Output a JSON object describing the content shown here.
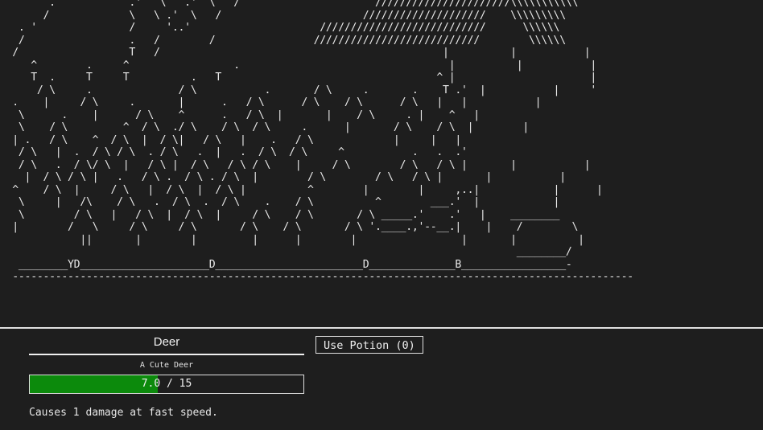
{
  "scene": {
    "art_lines": [
      "        .            .'   \\   .'  \\   /                      //////////////////////\\\\\\\\\\\\\\\\\\\\\\",
      "       /             \\   \\ .'  \\   /                       ////////////////////    \\\\\\\\\\\\\\\\\\",
      "   . '               /     '..'                     ///////////////////////////      \\\\\\\\\\\\",
      "   /                 .   /        /                ///////////////////////////        \\\\\\\\\\\\",
      "  /                  T   /                                              |          |           |",
      "     ^        .     ^                 .                                  |          |           |",
      "     T  .     T     T          .   T                                   ^ |                      |",
      "      / \\     .              / \\           .       / \\     .       .    T .'  |           |     '",
      "  .    |     / \\     .       |      .   / \\      / \\    / \\      / \\   |   |           |",
      "   \\      .    |      / \\    ^      .   / \\  |       |    / \\     . |    ^   |",
      "   \\    / \\         ^  / \\  ./ \\    / \\  / \\     .      |       / \\    / \\  |        |",
      "  | .   / \\    ^  / \\  |  / \\|   / \\   |    .   / \\             |     |   |",
      "   / \\   |  .  / \\ / \\  . / \\   .  |   .  / \\  / \\     ^           .   .  .'",
      "   / \\   .  / \\/ \\  |   / \\ |  / \\   / \\ / \\    |     / \\        / \\   / \\ |       |           |",
      "    |  / \\ / \\ |   .   / \\ .  / \\ . / \\  |        / \\        / \\   / \\ |       |           |",
      "  ^    / \\  |     / \\   |  / \\  |  / \\ |          ^        |        |     ,..|            |      |",
      "   \\     |   /\\    / \\   .  / \\  .  / \\    .    / \\          ^        ___.'  |            |",
      "   \\        / \\   |   / \\  |  / \\  |     / \\    / \\       / \\ _____.'    .'   |    ________",
      "  |        /   \\     / \\     / \\       / \\    / \\       / \\ '.____.,'--__.|    |    /        \\",
      "             ||       |        |         |      |        |                 |       |          |",
      "                                                                                    ________/",
      "   ________YD_____________________D________________________D______________B_________________-",
      "  -----------------------------------------------------------------------------------------------------"
    ]
  },
  "enemy": {
    "name": "Deer",
    "subtitle": "A Cute Deer",
    "hp_current": 7.0,
    "hp_max": 15,
    "hp_text": "7.0 / 15",
    "description": "Causes 1 damage at fast speed."
  },
  "actions": {
    "potion_label": "Use Potion (0)"
  },
  "colors": {
    "background": "#1e1e1e",
    "foreground": "#e6e6e6",
    "hp_fill": "#0c8a0c"
  }
}
